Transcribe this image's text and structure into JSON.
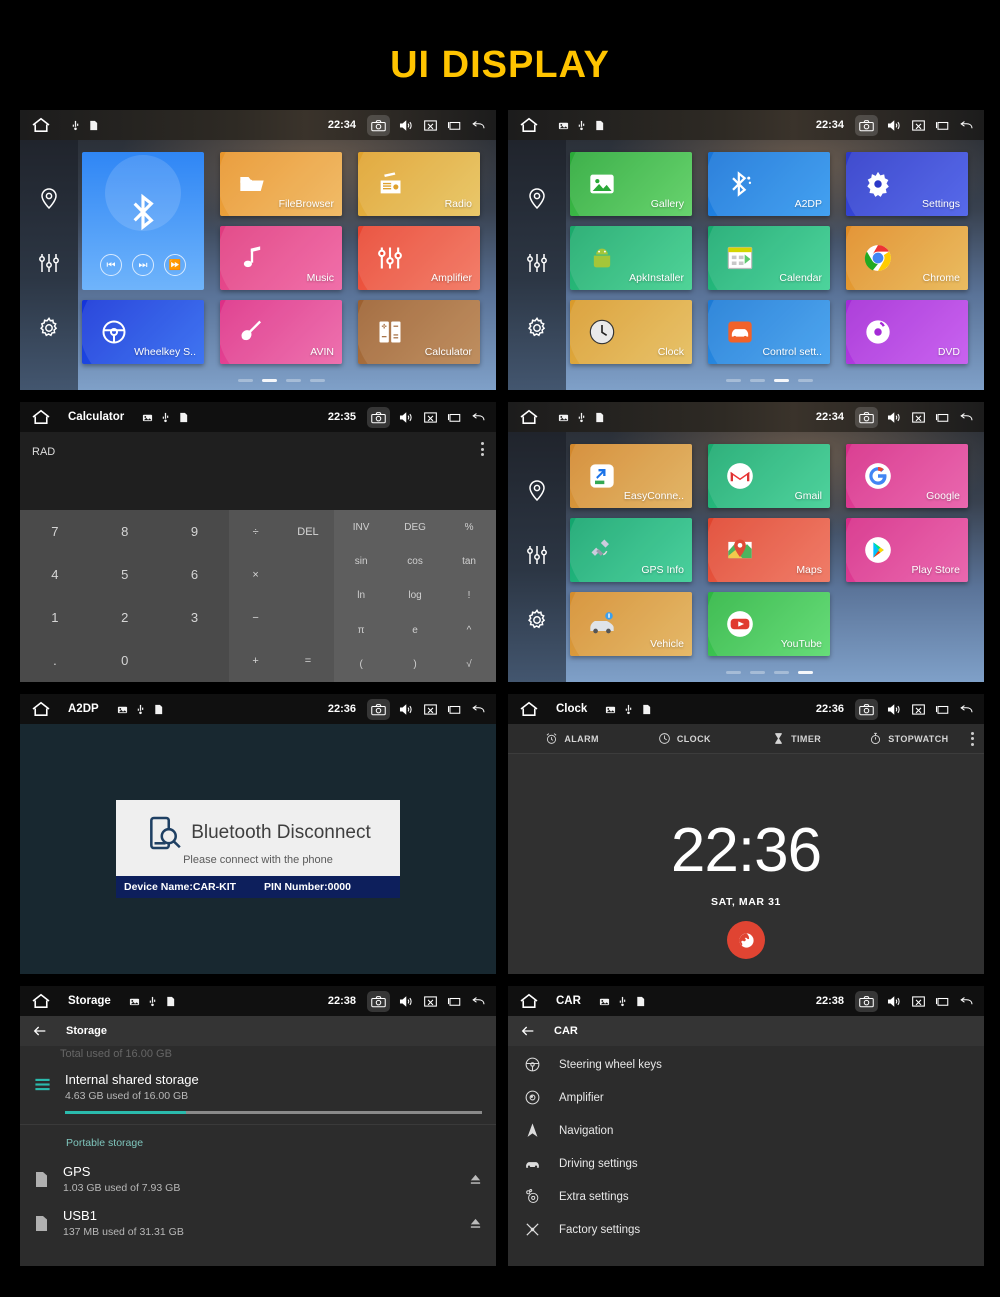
{
  "title": "UI DISPLAY",
  "common": {
    "home_icon": "home-icon",
    "camera_icon": "camera-icon",
    "volume_icon": "volume-icon",
    "close_icon": "close-box-icon",
    "recents_icon": "recents-icon",
    "back_icon": "back-icon",
    "usb_icon": "usb-icon",
    "sdcard_icon": "sdcard-icon",
    "screenshot_icon": "image-icon"
  },
  "panels": [
    {
      "id": "launcher-page-1",
      "statusbar": {
        "title": "",
        "time": "22:34",
        "minis": [
          "usb-icon",
          "sdcard-icon"
        ]
      },
      "sidebar": [
        "location-pin-icon",
        "equalizer-icon",
        "gear-icon"
      ],
      "bluetooth_widget": {
        "icon": "bluetooth-icon",
        "prev_label": "⏮",
        "playpause_label": "⏭",
        "next_label": "⏩"
      },
      "tiles": [
        {
          "label": "FileBrowser",
          "icon": "folder-icon",
          "color": "#e8942a",
          "color2": "#f0b457"
        },
        {
          "label": "Radio",
          "icon": "radio-icon",
          "color": "#dfa12c",
          "color2": "#e7c25a"
        },
        {
          "label": "Music",
          "icon": "music-note-icon",
          "color": "#e03a7e",
          "color2": "#ef5fa0"
        },
        {
          "label": "Amplifier",
          "icon": "equalizer-icon",
          "color": "#e8442f",
          "color2": "#f2705a"
        },
        {
          "label": "Wheelkey S..",
          "icon": "steering-wheel-icon",
          "color": "#1433d8",
          "color2": "#2a66f0"
        },
        {
          "label": "AVIN",
          "icon": "avin-plug-icon",
          "color": "#dd2f86",
          "color2": "#ec62a6"
        },
        {
          "label": "Calculator",
          "icon": "calculator-icon",
          "color": "#9c6030",
          "color2": "#b8824e"
        }
      ],
      "dots": [
        false,
        true,
        false,
        false
      ]
    },
    {
      "id": "launcher-page-2",
      "statusbar": {
        "title": "",
        "time": "22:34",
        "minis": [
          "image-icon",
          "usb-icon",
          "sdcard-icon"
        ]
      },
      "sidebar": [
        "location-pin-icon",
        "equalizer-icon",
        "gear-icon"
      ],
      "tiles": [
        {
          "label": "Gallery",
          "icon": "gallery-icon",
          "color": "#29a837",
          "color2": "#57cf5e"
        },
        {
          "label": "A2DP",
          "icon": "bluetooth-icon",
          "color": "#1673d8",
          "color2": "#2f97ef"
        },
        {
          "label": "Settings",
          "icon": "gear-icon",
          "color": "#2b38c8",
          "color2": "#4459e8"
        },
        {
          "label": "ApkInstaller",
          "icon": "android-icon",
          "color": "#1aa86a",
          "color2": "#3ccf8d"
        },
        {
          "label": "Calendar",
          "icon": "calendar-icon",
          "color": "#17a96e",
          "color2": "#39cf91"
        },
        {
          "label": "Chrome",
          "icon": "chrome-icon",
          "color": "#e08a22",
          "color2": "#e8b54f"
        },
        {
          "label": "Clock",
          "icon": "clock-icon",
          "color": "#d99a2b",
          "color2": "#e5bc59"
        },
        {
          "label": "Control sett..",
          "icon": "car-control-icon",
          "color": "#1b7ad6",
          "color2": "#3b9cee"
        },
        {
          "label": "DVD",
          "icon": "dvd-icon",
          "color": "#a42ad6",
          "color2": "#c352ee"
        }
      ],
      "dots": [
        false,
        false,
        true,
        false
      ]
    },
    {
      "id": "calculator",
      "statusbar": {
        "title": "Calculator",
        "time": "22:35",
        "minis": [
          "image-icon",
          "usb-icon",
          "sdcard-icon"
        ]
      },
      "mode_label": "RAD",
      "overflow_icon": "kebab-menu-icon",
      "numpad": [
        "7",
        "8",
        "9",
        "4",
        "5",
        "6",
        "1",
        "2",
        "3",
        ".",
        "0",
        ""
      ],
      "oppad": [
        "÷",
        "DEL",
        "×",
        "",
        "−",
        "",
        "+",
        "="
      ],
      "fnpad": [
        "INV",
        "DEG",
        "%",
        "sin",
        "cos",
        "tan",
        "ln",
        "log",
        "!",
        "π",
        "e",
        "^",
        "(",
        ")",
        "√"
      ]
    },
    {
      "id": "launcher-page-3",
      "statusbar": {
        "title": "",
        "time": "22:34",
        "minis": [
          "image-icon",
          "usb-icon",
          "sdcard-icon"
        ]
      },
      "sidebar": [
        "location-pin-icon",
        "equalizer-icon",
        "gear-icon"
      ],
      "tiles": [
        {
          "label": "EasyConne..",
          "icon": "easyconnect-icon",
          "color": "#d2862a",
          "color2": "#e0ae57"
        },
        {
          "label": "Gmail",
          "icon": "gmail-icon",
          "color": "#18a86d",
          "color2": "#3bce92"
        },
        {
          "label": "Google",
          "icon": "google-icon",
          "color": "#d62a86",
          "color2": "#e857a6"
        },
        {
          "label": "GPS Info",
          "icon": "satellite-icon",
          "color": "#13a56d",
          "color2": "#36cb92"
        },
        {
          "label": "Maps",
          "icon": "maps-pin-icon",
          "color": "#e0432c",
          "color2": "#ee6e58"
        },
        {
          "label": "Play Store",
          "icon": "play-store-icon",
          "color": "#d62a86",
          "color2": "#e857a6"
        },
        {
          "label": "Vehicle",
          "icon": "vehicle-car-icon",
          "color": "#d48c2c",
          "color2": "#e2b158"
        },
        {
          "label": "YouTube",
          "icon": "youtube-icon",
          "color": "#2cb541",
          "color2": "#56d96a"
        }
      ],
      "dots": [
        false,
        false,
        false,
        true
      ]
    },
    {
      "id": "a2dp-bluetooth",
      "statusbar": {
        "title": "A2DP",
        "time": "22:36",
        "minis": [
          "image-icon",
          "usb-icon",
          "sdcard-icon"
        ]
      },
      "card": {
        "icon": "phone-search-icon",
        "heading": "Bluetooth Disconnect",
        "subheading": "Please connect with the phone",
        "device_name": "Device Name:CAR-KIT",
        "pin_number": "PIN Number:0000"
      }
    },
    {
      "id": "clock-app",
      "statusbar": {
        "title": "Clock",
        "time": "22:36",
        "minis": [
          "image-icon",
          "usb-icon",
          "sdcard-icon"
        ]
      },
      "tabs": [
        {
          "label": "ALARM",
          "icon": "alarm-icon"
        },
        {
          "label": "CLOCK",
          "icon": "clock-icon"
        },
        {
          "label": "TIMER",
          "icon": "hourglass-icon"
        },
        {
          "label": "STOPWATCH",
          "icon": "stopwatch-icon"
        }
      ],
      "overflow_icon": "kebab-menu-icon",
      "time": "22:36",
      "date": "SAT, MAR 31",
      "fab_icon": "globe-icon",
      "fab_color": "#e04432"
    },
    {
      "id": "storage-settings",
      "statusbar": {
        "title": "Storage",
        "time": "22:38",
        "minis": [
          "image-icon",
          "usb-icon",
          "sdcard-icon"
        ]
      },
      "back_icon": "arrow-back-icon",
      "screen_title": "Storage",
      "cut_line": "Total used of 16.00 GB",
      "internal": {
        "icon": "storage-list-icon",
        "title": "Internal shared storage",
        "subtitle": "4.63 GB used of 16.00 GB",
        "percent": 29,
        "bar_color": "#2bbbad"
      },
      "section_label": "Portable storage",
      "portable": [
        {
          "icon": "sdcard-icon",
          "title": "GPS",
          "subtitle": "1.03 GB used of 7.93 GB",
          "eject_icon": "eject-icon"
        },
        {
          "icon": "sdcard-icon",
          "title": "USB1",
          "subtitle": "137 MB used of 31.31 GB",
          "eject_icon": "eject-icon"
        }
      ]
    },
    {
      "id": "car-settings",
      "statusbar": {
        "title": "CAR",
        "time": "22:38",
        "minis": [
          "image-icon",
          "usb-icon",
          "sdcard-icon"
        ]
      },
      "back_icon": "arrow-back-icon",
      "screen_title": "CAR",
      "items": [
        {
          "label": "Steering wheel keys",
          "icon": "steering-wheel-icon"
        },
        {
          "label": "Amplifier",
          "icon": "speaker-icon"
        },
        {
          "label": "Navigation",
          "icon": "navigation-arrow-icon"
        },
        {
          "label": "Driving settings",
          "icon": "car-icon"
        },
        {
          "label": "Extra settings",
          "icon": "gear-plus-icon"
        },
        {
          "label": "Factory settings",
          "icon": "tools-icon"
        }
      ]
    }
  ]
}
